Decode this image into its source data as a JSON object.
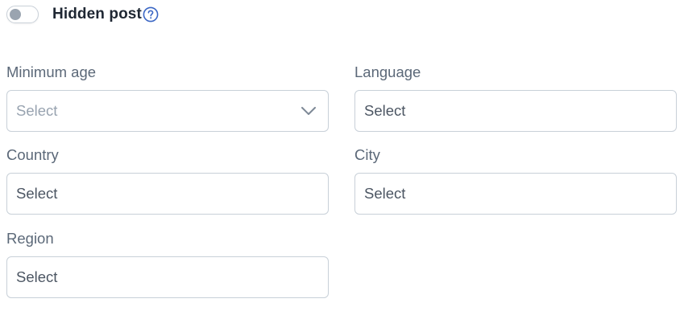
{
  "hidden_post": {
    "label": "Hidden post",
    "enabled": false
  },
  "fields": {
    "minimum_age": {
      "label": "Minimum age",
      "value": "Select"
    },
    "language": {
      "label": "Language",
      "value": "Select"
    },
    "country": {
      "label": "Country",
      "value": "Select"
    },
    "city": {
      "label": "City",
      "value": "Select"
    },
    "region": {
      "label": "Region",
      "value": "Select"
    }
  },
  "icons": {
    "help": "question-circle-icon",
    "dropdown": "chevron-down-icon"
  },
  "colors": {
    "accent": "#3a66c4",
    "label_text": "#5b6878",
    "heading_text": "#1f2733",
    "border": "#c8d0d8",
    "placeholder": "#98a3b0",
    "toggle_knob": "#9aa4b0"
  }
}
